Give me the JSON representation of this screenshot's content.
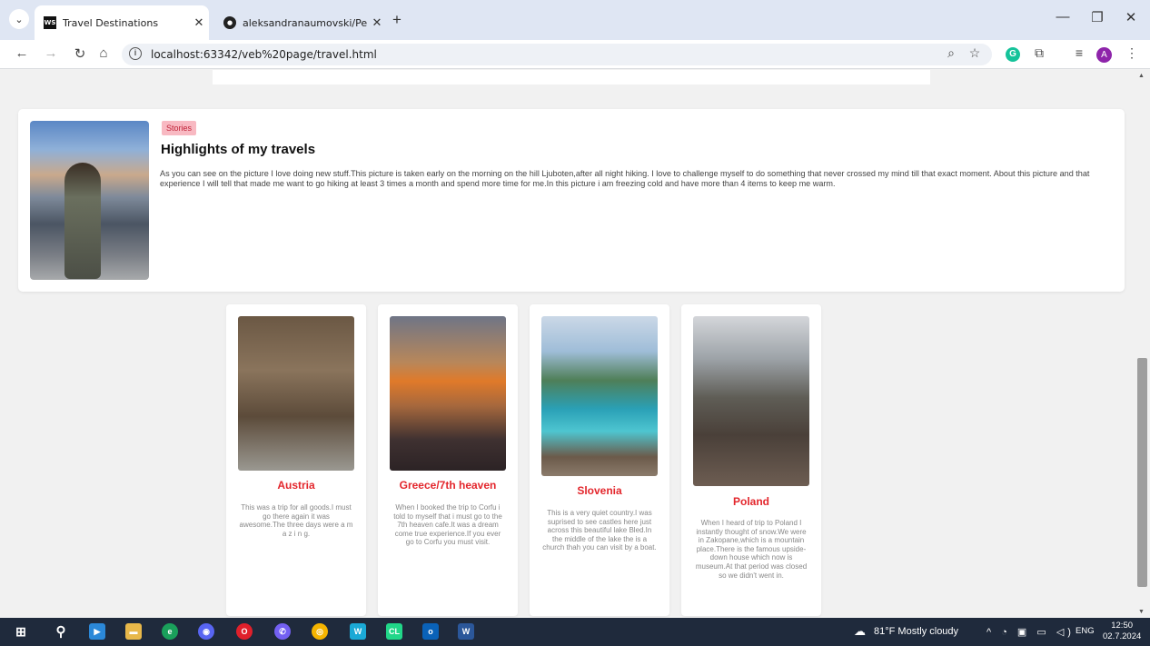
{
  "browser": {
    "tabs": [
      {
        "title": "Travel Destinations",
        "icon": "webstorm-icon",
        "close": "✕"
      },
      {
        "title": "aleksandranaumovski/Personal",
        "icon": "github-icon",
        "close": "✕"
      }
    ],
    "new_tab": "+",
    "url": "localhost:63342/veb%20page/travel.html",
    "profile_initial": "A"
  },
  "story": {
    "badge": "Stories",
    "title": "Highlights of my travels",
    "text": "As you can see on the picture I love doing new stuff.This picture is taken early on the morning on the hill Ljuboten,after all night hiking. I love to challenge myself to do something that never crossed my mind till that exact moment. About this picture and that experience I will tell that made me want to go hiking at least 3 times a month and spend more time for me.In this picture i am freezing cold and have more than 4 items to keep me warm."
  },
  "cards": [
    {
      "title": "Austria",
      "text": "This was a trip for all goods.I must go there again it was awesome.The three days were a m a z i n g."
    },
    {
      "title": "Greece/7th heaven",
      "text": "When I booked the trip to Corfu i told to myself that i must go to the 7th heaven cafe.It was a dream come true experience.If you ever go to Corfu you must visit."
    },
    {
      "title": "Slovenia",
      "text": "This is a very quiet country.I was suprised to see castles here just across this beautiful lake Bled.In the middle of the lake the is a church thah you can visit by a boat."
    },
    {
      "title": "Poland",
      "text": "When I heard of trip to Poland I instantly thought of snow.We were in Zakopane,which is a mountain place.There is the famous upside-down house which now is museum.At that period was closed so we didn't went in."
    }
  ],
  "taskbar": {
    "weather": "81°F  Mostly cloudy",
    "language": "ENG",
    "time": "12:50",
    "date": "02.7.2024"
  },
  "colors": {
    "accent_red": "#e3262c",
    "badge_bg": "#f8b9c2",
    "taskbar": "#1f2a3c"
  }
}
